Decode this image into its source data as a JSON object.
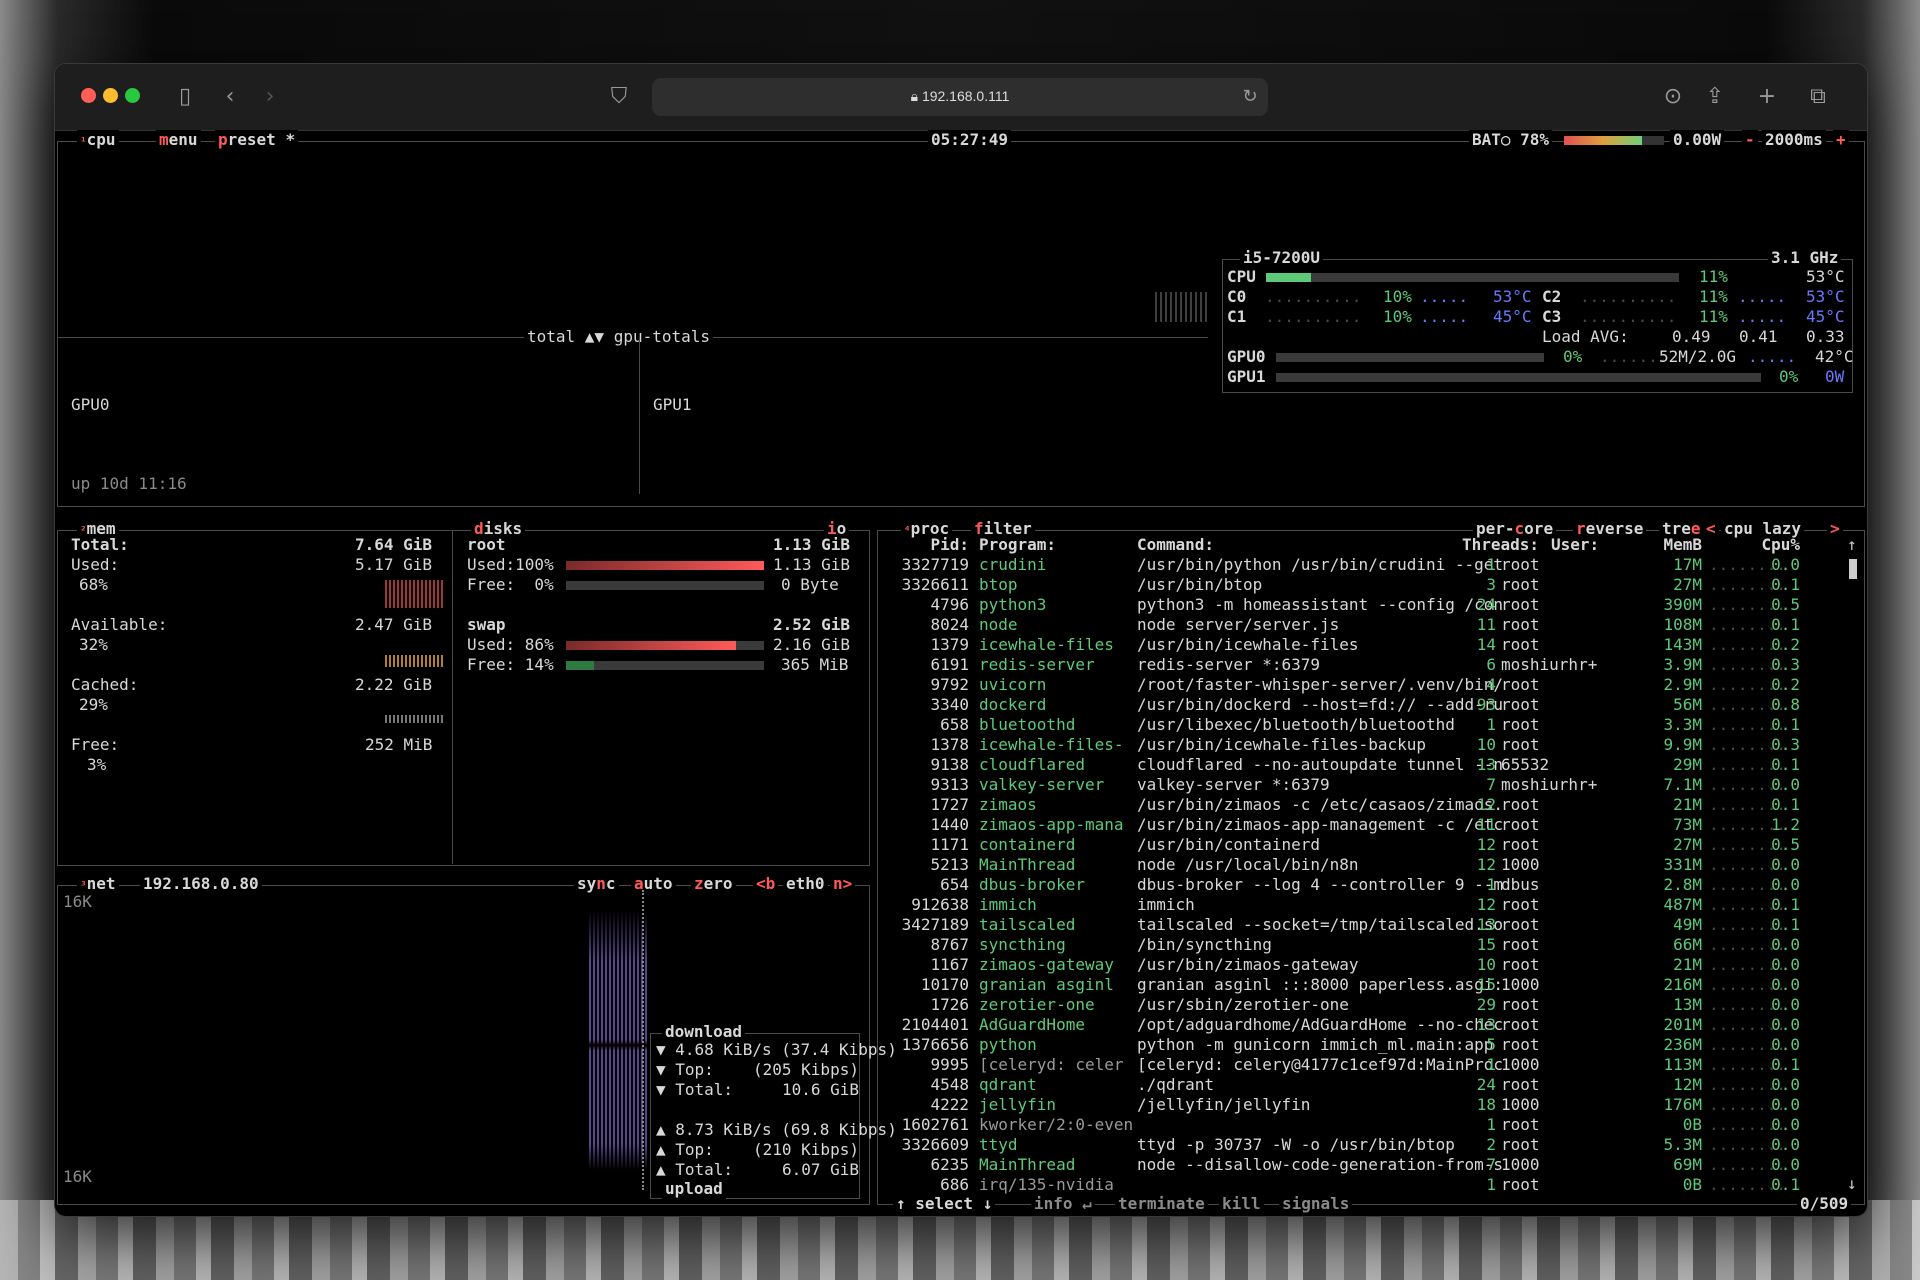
{
  "browser": {
    "url": "192.168.0.111"
  },
  "cpu": {
    "tab_num": "¹",
    "tab": "cpu",
    "menu": "menu",
    "preset": "preset *",
    "clock": "05:27:49",
    "battery": "BAT○ 78%",
    "power": "0.00W",
    "interval": "2000ms",
    "minus": "-",
    "plus": "+",
    "model": "i5-7200U",
    "freq": "3.1 GHz",
    "cpu_label": "CPU",
    "cpu_pct": "11%",
    "cpu_temp": "53°C",
    "cpu_value": 0.11,
    "cores": [
      {
        "name": "C0",
        "pct": "10%",
        "temp": "53°C"
      },
      {
        "name": "C1",
        "pct": "10%",
        "temp": "45°C"
      },
      {
        "name": "C2",
        "pct": "11%",
        "temp": "53°C"
      },
      {
        "name": "C3",
        "pct": "11%",
        "temp": "45°C"
      }
    ],
    "load_label": "Load AVG:",
    "load": [
      "0.49",
      "0.41",
      "0.33"
    ],
    "gpus": [
      {
        "name": "GPU0",
        "pct": "0%",
        "mem": "52M/2.0G",
        "temp": "42°C"
      },
      {
        "name": "GPU1",
        "pct": "0%",
        "power": "0W"
      }
    ],
    "graph_label": "total ▲▼ gpu-totals",
    "gpu0_label": "GPU0",
    "gpu1_label": "GPU1",
    "uptime": "up 10d 11:16"
  },
  "mem": {
    "tab_num": "²",
    "tab": "mem",
    "total_label": "Total:",
    "total": "7.64 GiB",
    "items": [
      {
        "label": "Used:",
        "value": "5.17 GiB",
        "pct": "68%"
      },
      {
        "label": "Available:",
        "value": "2.47 GiB",
        "pct": "32%"
      },
      {
        "label": "Cached:",
        "value": "2.22 GiB",
        "pct": "29%"
      },
      {
        "label": "Free:",
        "value": "252 MiB",
        "pct": "3%"
      }
    ]
  },
  "disks": {
    "tab": "disks",
    "io": "io",
    "root_label": "root",
    "root_size": "1.13 GiB",
    "root_used_label": "Used:100%",
    "root_used": "1.13 GiB",
    "root_used_value": 1.0,
    "root_free_label": "Free:  0%",
    "root_free": "0 Byte",
    "root_free_value": 0.0,
    "swap_label": "swap",
    "swap_size": "2.52 GiB",
    "swap_used_label": "Used: 86%",
    "swap_used": "2.16 GiB",
    "swap_used_value": 0.86,
    "swap_free_label": "Free: 14%",
    "swap_free": "365 MiB",
    "swap_free_value": 0.14
  },
  "net": {
    "tab_num": "³",
    "tab": "net",
    "ip": "192.168.0.80",
    "sync": "sync",
    "auto": "auto",
    "zero": "zero",
    "iface_prev": "<b",
    "iface": "eth0",
    "iface_next": "n>",
    "scale_top": "16K",
    "scale_bottom": "16K",
    "download_label": "download",
    "dl_rate": "▼ 4.68 KiB/s (37.4 Kibps)",
    "dl_top_label": "▼ Top:",
    "dl_top": "(205 Kibps)",
    "dl_total_label": "▼ Total:",
    "dl_total": "10.6 GiB",
    "ul_rate": "▲ 8.73 KiB/s (69.8 Kibps)",
    "ul_top_label": "▲ Top:",
    "ul_top": "(210 Kibps)",
    "ul_total_label": "▲ Total:",
    "ul_total": "6.07 GiB",
    "upload_label": "upload"
  },
  "proc": {
    "tab_num": "⁴",
    "tab": "proc",
    "filter": "filter",
    "per_core": "per-core",
    "reverse": "reverse",
    "tree": "tree",
    "sort_prev": "<",
    "sort": "cpu lazy",
    "sort_next": ">",
    "headers": {
      "pid": "Pid:",
      "program": "Program:",
      "command": "Command:",
      "threads": "Threads:",
      "user": "User:",
      "mem": "MemB",
      "cpu": "Cpu%"
    },
    "rows": [
      [
        "3327719",
        "crudini",
        "/usr/bin/python /usr/bin/crudini --get",
        "1",
        "root",
        "17M",
        "0.0"
      ],
      [
        "3326611",
        "btop",
        "/usr/bin/btop",
        "3",
        "root",
        "27M",
        "0.1"
      ],
      [
        "4796",
        "python3",
        "python3 -m homeassistant --config /con",
        "24",
        "root",
        "390M",
        "0.5"
      ],
      [
        "8024",
        "node",
        "node server/server.js",
        "11",
        "root",
        "108M",
        "0.1"
      ],
      [
        "1379",
        "icewhale-files",
        "/usr/bin/icewhale-files",
        "14",
        "root",
        "143M",
        "0.2"
      ],
      [
        "6191",
        "redis-server",
        "redis-server *:6379",
        "6",
        "moshiurhr+",
        "3.9M",
        "0.3"
      ],
      [
        "9792",
        "uvicorn",
        "/root/faster-whisper-server/.venv/bin/",
        "4",
        "root",
        "2.9M",
        "0.2"
      ],
      [
        "3340",
        "dockerd",
        "/usr/bin/dockerd --host=fd:// --add-ru",
        "93",
        "root",
        "56M",
        "0.8"
      ],
      [
        "658",
        "bluetoothd",
        "/usr/libexec/bluetooth/bluetoothd",
        "1",
        "root",
        "3.3M",
        "0.1"
      ],
      [
        "1378",
        "icewhale-files-",
        "/usr/bin/icewhale-files-backup",
        "10",
        "root",
        "9.9M",
        "0.3"
      ],
      [
        "9138",
        "cloudflared",
        "cloudflared --no-autoupdate tunnel --n",
        "13",
        "65532",
        "29M",
        "0.1"
      ],
      [
        "9313",
        "valkey-server",
        "valkey-server *:6379",
        "7",
        "moshiurhr+",
        "7.1M",
        "0.0"
      ],
      [
        "1727",
        "zimaos",
        "/usr/bin/zimaos -c /etc/casaos/zimaos.",
        "12",
        "root",
        "21M",
        "0.1"
      ],
      [
        "1440",
        "zimaos-app-mana",
        "/usr/bin/zimaos-app-management -c /etc",
        "11",
        "root",
        "73M",
        "1.2"
      ],
      [
        "1171",
        "containerd",
        "/usr/bin/containerd",
        "12",
        "root",
        "27M",
        "0.5"
      ],
      [
        "5213",
        "MainThread",
        "node /usr/local/bin/n8n",
        "12",
        "1000",
        "331M",
        "0.0"
      ],
      [
        "654",
        "dbus-broker",
        "dbus-broker --log 4 --controller 9 --m",
        "1",
        "dbus",
        "2.8M",
        "0.0"
      ],
      [
        "912638",
        "immich",
        "immich",
        "12",
        "root",
        "487M",
        "0.1"
      ],
      [
        "3427189",
        "tailscaled",
        "tailscaled --socket=/tmp/tailscaled.so",
        "13",
        "root",
        "49M",
        "0.1"
      ],
      [
        "8767",
        "syncthing",
        "/bin/syncthing",
        "15",
        "root",
        "66M",
        "0.0"
      ],
      [
        "1167",
        "zimaos-gateway",
        "/usr/bin/zimaos-gateway",
        "10",
        "root",
        "21M",
        "0.0"
      ],
      [
        "10170",
        "granian asginl",
        "granian asginl :::8000 paperless.asgi:",
        "15",
        "1000",
        "216M",
        "0.0"
      ],
      [
        "1726",
        "zerotier-one",
        "/usr/sbin/zerotier-one",
        "29",
        "root",
        "13M",
        "0.0"
      ],
      [
        "2104401",
        "AdGuardHome",
        "/opt/adguardhome/AdGuardHome --no-chec",
        "13",
        "root",
        "201M",
        "0.0"
      ],
      [
        "1376656",
        "python",
        "python -m gunicorn immich_ml.main:app",
        "5",
        "root",
        "236M",
        "0.0"
      ],
      [
        "9995",
        "[celeryd: celer",
        "[celeryd: celery@4177c1cef97d:MainProc",
        "1",
        "1000",
        "113M",
        "0.1"
      ],
      [
        "4548",
        "qdrant",
        "./qdrant",
        "24",
        "root",
        "12M",
        "0.0"
      ],
      [
        "4222",
        "jellyfin",
        "/jellyfin/jellyfin",
        "18",
        "1000",
        "176M",
        "0.0"
      ],
      [
        "1602761",
        "kworker/2:0-even",
        "",
        "1",
        "root",
        "0B",
        "0.0"
      ],
      [
        "3326609",
        "ttyd",
        "ttyd -p 30737 -W -o /usr/bin/btop",
        "2",
        "root",
        "5.3M",
        "0.0"
      ],
      [
        "6235",
        "MainThread",
        "node --disallow-code-generation-from-s",
        "7",
        "1000",
        "69M",
        "0.0"
      ],
      [
        "686",
        "irq/135-nvidia",
        "",
        "1",
        "root",
        "0B",
        "0.1"
      ]
    ],
    "footer": {
      "select": "↑ select ↓",
      "info": "info ↵",
      "terminate": "terminate",
      "kill": "kill",
      "signals": "signals",
      "count": "0/509"
    }
  }
}
